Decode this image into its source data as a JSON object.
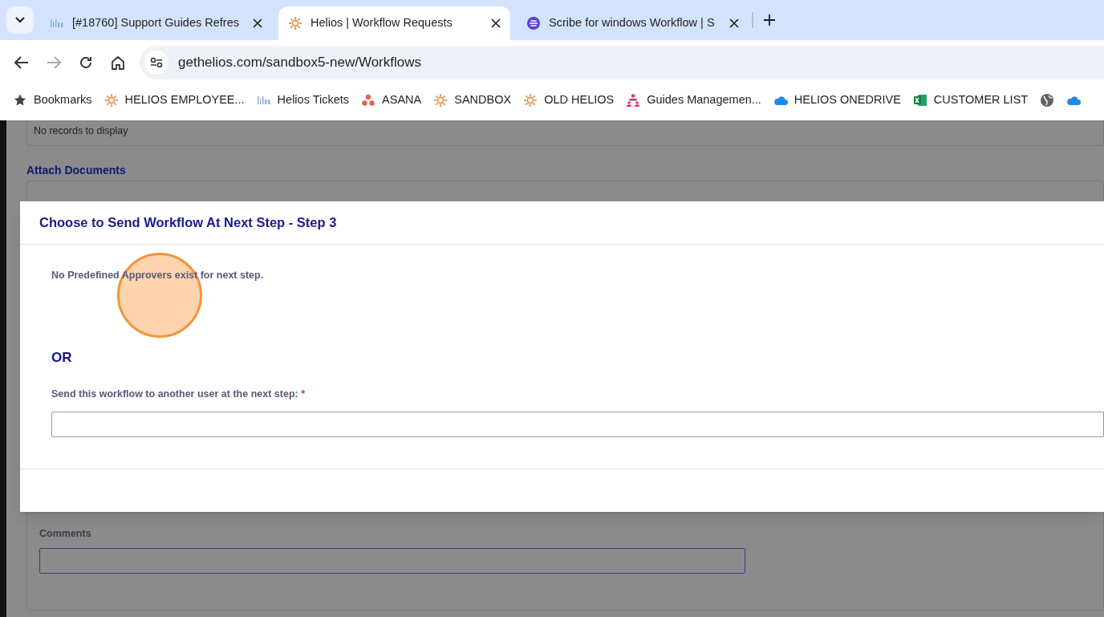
{
  "browser": {
    "tabs": [
      {
        "title": "[#18760] Support Guides Refres",
        "selected": false
      },
      {
        "title": "Helios | Workflow Requests",
        "selected": true
      },
      {
        "title": "Scribe for windows Workflow | S",
        "selected": false
      }
    ],
    "url": "gethelios.com/sandbox5-new/Workflows",
    "bookmarks": [
      {
        "label": "Bookmarks"
      },
      {
        "label": "HELIOS EMPLOYEE..."
      },
      {
        "label": "Helios Tickets"
      },
      {
        "label": "ASANA"
      },
      {
        "label": "SANDBOX"
      },
      {
        "label": "OLD HELIOS"
      },
      {
        "label": "Guides Managemen..."
      },
      {
        "label": "HELIOS ONEDRIVE"
      },
      {
        "label": "CUSTOMER LIST"
      }
    ]
  },
  "page": {
    "empty_message": "No records to display",
    "attach_heading": "Attach Documents",
    "comments_label": "Comments"
  },
  "modal": {
    "title": "Choose to Send Workflow At Next Step - Step 3",
    "notice": "No Predefined Approvers exist for next step.",
    "separator": "OR",
    "field_label": "Send this workflow to another user at the next step:",
    "required_mark": "*"
  }
}
